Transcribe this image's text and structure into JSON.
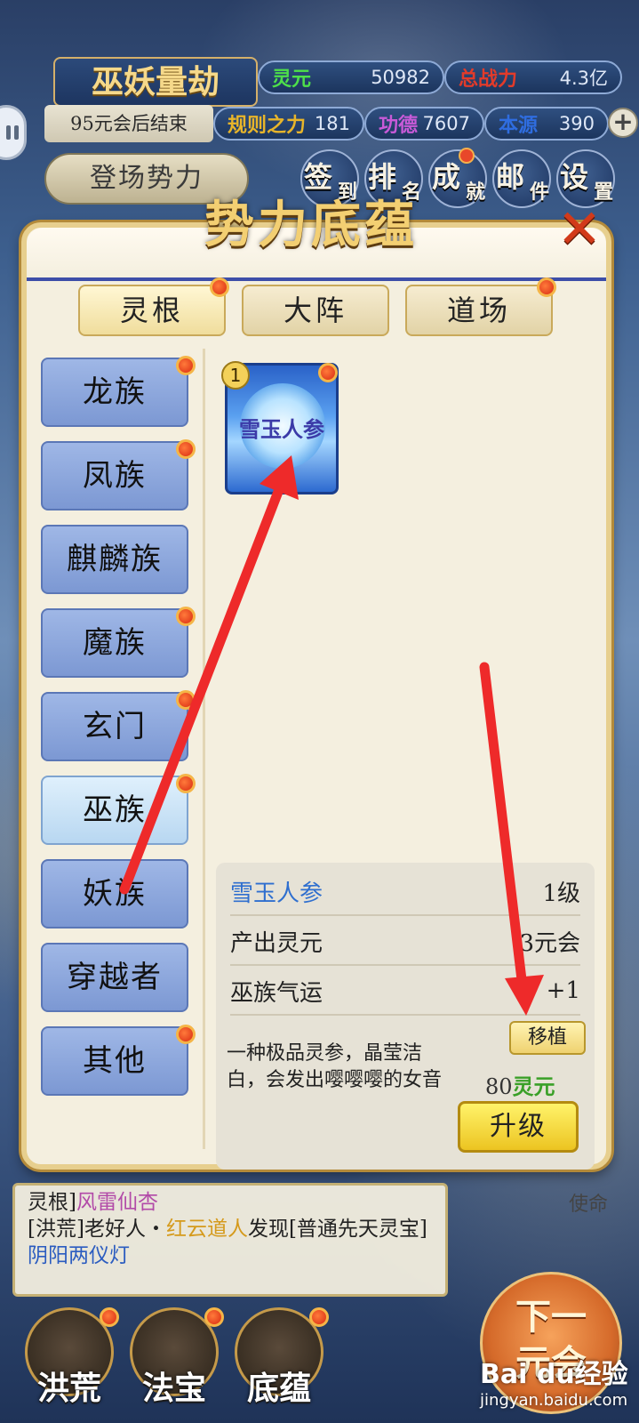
{
  "header": {
    "game_title": "巫妖量劫",
    "end_notice": "95元会后结束",
    "stats": [
      {
        "label": "灵元",
        "value": "50982",
        "label_color": "#4ee04a"
      },
      {
        "label": "总战力",
        "value": "4.3亿",
        "label_color": "#e33b2a"
      },
      {
        "label": "规则之力",
        "value": "181",
        "label_color": "#e8b52a"
      },
      {
        "label": "功德",
        "value": "7607",
        "label_color": "#c85ad8"
      },
      {
        "label": "本源",
        "value": "390",
        "label_color": "#2f6de0"
      }
    ],
    "faction_button": "登场势力",
    "nav": [
      {
        "big": "签",
        "small": "到"
      },
      {
        "big": "排",
        "small": "名"
      },
      {
        "big": "成",
        "small": "就"
      },
      {
        "big": "邮",
        "small": "件"
      },
      {
        "big": "设",
        "small": "置"
      }
    ]
  },
  "modal": {
    "title": "势力底蕴",
    "tabs": [
      "灵根",
      "大阵",
      "道场"
    ],
    "categories": [
      "龙族",
      "凤族",
      "麒麟族",
      "魔族",
      "玄门",
      "巫族",
      "妖族",
      "穿越者",
      "其他"
    ],
    "selected_category": "巫族",
    "item": {
      "name": "雪玉人参",
      "level_badge": "1"
    },
    "detail": {
      "name": "雪玉人参",
      "level": "1级",
      "rows": [
        {
          "label": "产出灵元",
          "value": "3元会"
        },
        {
          "label": "巫族气运",
          "value": "+1"
        }
      ],
      "description": "一种极品灵参，晶莹洁白，会发出嘤嘤嘤的女音",
      "move_label": "移植",
      "cost_amount": "80",
      "cost_currency": "灵元",
      "upgrade_label": "升级"
    }
  },
  "log": {
    "line1_prefix": "灵根]",
    "line1_item": "风雷仙杏",
    "line2_a": "[洪荒]老好人・",
    "line2_b": "红云道人",
    "line2_c": "发现[普通先天灵宝]",
    "line2_d": "阴阳两仪灯",
    "right_cut": "使命"
  },
  "bottom_nav": [
    "洪荒",
    "法宝",
    "底蕴"
  ],
  "next_button": {
    "line1": "下一",
    "line2": "元会"
  },
  "watermark": {
    "logo": "Bai du经验",
    "url": "jingyan.baidu.com"
  }
}
